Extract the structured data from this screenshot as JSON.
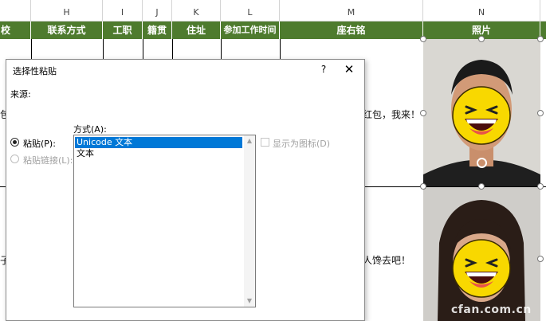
{
  "sheet": {
    "column_letters": [
      "H",
      "I",
      "J",
      "K",
      "L",
      "M",
      "N"
    ],
    "header_row": [
      "校",
      "联系方式",
      "工职",
      "籍贯",
      "住址",
      "参加工作时间",
      "座右铭",
      "照片"
    ],
    "row1_left_fragment": "包",
    "row1_motto_fragment": "红包，我来！",
    "row2_left_fragment": "子",
    "row2_motto_fragment": "人馋去吧！"
  },
  "watermark": "cfan.com.cn",
  "dialog": {
    "title": "选择性粘贴",
    "help": "?",
    "close": "✕",
    "source_label": "来源:",
    "mode_label": "方式(A):",
    "paste_label": "粘贴(P):",
    "paste_link_label": "粘贴链接(L):",
    "as_icon_label": "显示为图标(D)",
    "options": [
      "Unicode 文本",
      "文本"
    ],
    "selected_option": "Unicode 文本"
  },
  "colors": {
    "header_green": "#4e7b2e",
    "selection_blue": "#0078d7"
  }
}
